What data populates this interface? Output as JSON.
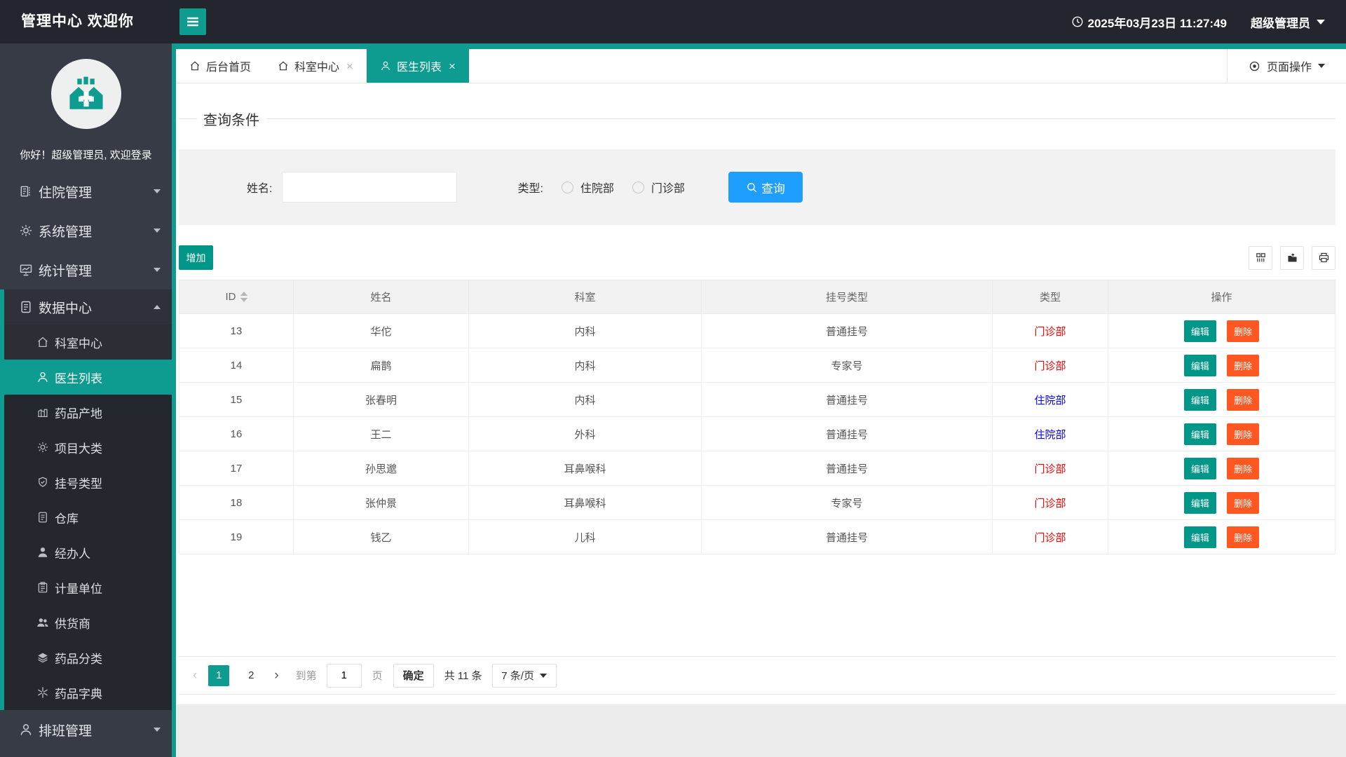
{
  "header": {
    "title": "管理中心 欢迎你",
    "datetime": "2025年03月23日 11:27:49",
    "user": "超级管理员"
  },
  "sidebar": {
    "greeting": "你好！超级管理员, 欢迎登录",
    "items": [
      {
        "icon": "book",
        "label": "住院管理",
        "cls": "",
        "caret": "down"
      },
      {
        "icon": "gear",
        "label": "系统管理",
        "cls": "",
        "caret": "down"
      },
      {
        "icon": "chart",
        "label": "统计管理",
        "cls": "",
        "caret": "down"
      },
      {
        "icon": "doc",
        "label": "数据中心",
        "cls": "open grp",
        "caret": "up"
      },
      {
        "icon": "home",
        "label": "科室中心",
        "cls": "sub grp hov",
        "caret": "none"
      },
      {
        "icon": "user",
        "label": "医生列表",
        "cls": "sub grp active",
        "caret": "none"
      },
      {
        "icon": "factory",
        "label": "药品产地",
        "cls": "sub grp",
        "caret": "none"
      },
      {
        "icon": "gear",
        "label": "项目大类",
        "cls": "sub grp",
        "caret": "none"
      },
      {
        "icon": "shield",
        "label": "挂号类型",
        "cls": "sub grp",
        "caret": "none"
      },
      {
        "icon": "doc",
        "label": "仓库",
        "cls": "sub grp",
        "caret": "none"
      },
      {
        "icon": "usersol",
        "label": "经办人",
        "cls": "sub grp",
        "caret": "none"
      },
      {
        "icon": "clip",
        "label": "计量单位",
        "cls": "sub grp",
        "caret": "none"
      },
      {
        "icon": "users",
        "label": "供货商",
        "cls": "sub grp",
        "caret": "none"
      },
      {
        "icon": "layers",
        "label": "药品分类",
        "cls": "sub grp",
        "caret": "none"
      },
      {
        "icon": "aster",
        "label": "药品字典",
        "cls": "sub grp",
        "caret": "none"
      },
      {
        "icon": "user",
        "label": "排班管理",
        "cls": "",
        "caret": "down"
      }
    ]
  },
  "tabs": {
    "items": [
      {
        "icon": "home",
        "label": "后台首页",
        "cls": "no-close"
      },
      {
        "icon": "home",
        "label": "科室中心",
        "cls": ""
      },
      {
        "icon": "user",
        "label": "医生列表",
        "cls": "active"
      }
    ],
    "close_glyph": "×",
    "page_ops": "页面操作"
  },
  "filter": {
    "title": "查询条件",
    "name_label": "姓名:",
    "name_value": "",
    "type_label": "类型:",
    "radios": [
      {
        "label": "住院部"
      },
      {
        "label": "门诊部"
      }
    ],
    "search_label": "查询"
  },
  "toolbar": {
    "add_label": "增加",
    "icons": [
      {
        "icon": "columns",
        "name": "columns-filter"
      },
      {
        "icon": "export",
        "name": "export"
      },
      {
        "icon": "print",
        "name": "print"
      }
    ]
  },
  "table": {
    "columns": [
      {
        "label": "ID",
        "cls": "sortable"
      },
      {
        "label": "姓名",
        "cls": ""
      },
      {
        "label": "科室",
        "cls": ""
      },
      {
        "label": "挂号类型",
        "cls": ""
      },
      {
        "label": "类型",
        "cls": ""
      },
      {
        "label": "操作",
        "cls": ""
      }
    ],
    "edit_label": "编辑",
    "delete_label": "删除",
    "rows": [
      {
        "id": "13",
        "name": "华佗",
        "dept": "内科",
        "reg": "普通挂号",
        "type": "门诊部",
        "type_class": "type-red"
      },
      {
        "id": "14",
        "name": "扁鹊",
        "dept": "内科",
        "reg": "专家号",
        "type": "门诊部",
        "type_class": "type-red"
      },
      {
        "id": "15",
        "name": "张春明",
        "dept": "内科",
        "reg": "普通挂号",
        "type": "住院部",
        "type_class": "type-blue"
      },
      {
        "id": "16",
        "name": "王二",
        "dept": "外科",
        "reg": "普通挂号",
        "type": "住院部",
        "type_class": "type-blue"
      },
      {
        "id": "17",
        "name": "孙思邈",
        "dept": "耳鼻喉科",
        "reg": "普通挂号",
        "type": "门诊部",
        "type_class": "type-red"
      },
      {
        "id": "18",
        "name": "张仲景",
        "dept": "耳鼻喉科",
        "reg": "专家号",
        "type": "门诊部",
        "type_class": "type-red"
      },
      {
        "id": "19",
        "name": "钱乙",
        "dept": "儿科",
        "reg": "普通挂号",
        "type": "门诊部",
        "type_class": "type-red"
      }
    ]
  },
  "pagination": {
    "prev": "‹",
    "next": "›",
    "pages": [
      {
        "label": "1",
        "cls": "active"
      },
      {
        "label": "2",
        "cls": ""
      }
    ],
    "goto_label": "到第",
    "goto_value": "1",
    "page_label": "页",
    "confirm_label": "确定",
    "total": "共 11 条",
    "per_page": "7 条/页"
  },
  "colors": {
    "accent_teal": "#0D9C8F",
    "button_teal": "#009688",
    "button_orange": "#FF5722",
    "search_blue": "#1E9FFF",
    "type_red": "#FF0000",
    "type_blue": "#0000FF",
    "header_bg": "#23262E",
    "sidebar_bg": "#373B45"
  }
}
